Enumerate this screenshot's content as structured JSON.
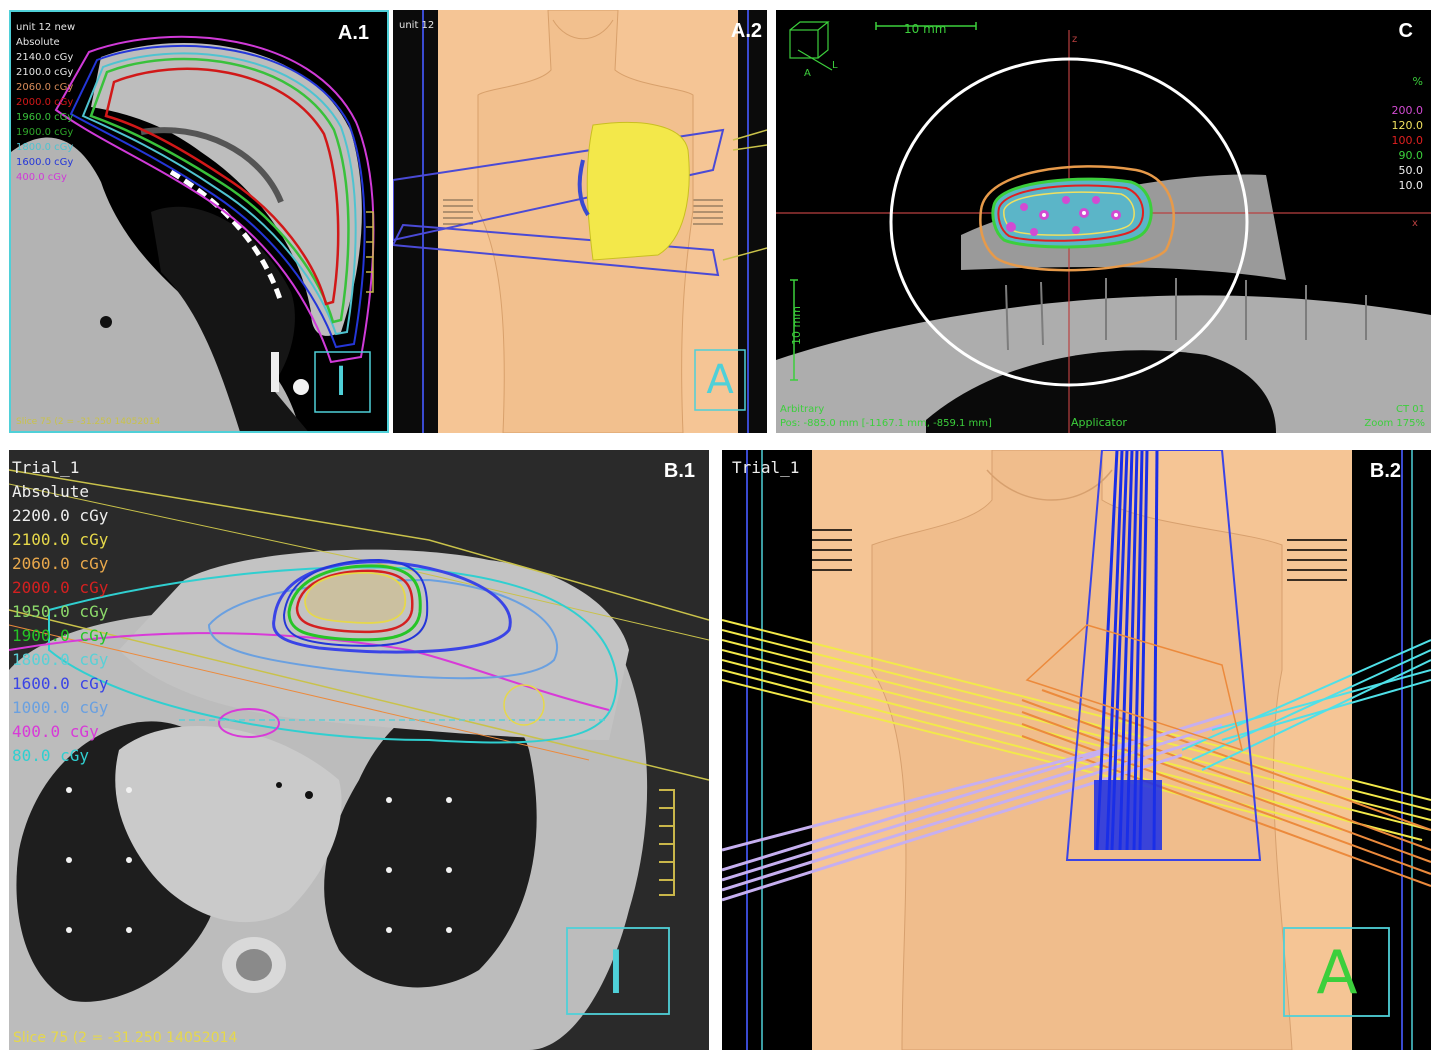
{
  "panels": {
    "a1": {
      "label": "A.1",
      "plan_name": "unit 12 new",
      "mode": "Absolute",
      "levels": [
        {
          "text": "2140.0 cGy",
          "color": "#e6e6e6"
        },
        {
          "text": "2100.0 cGy",
          "color": "#e6e6e6"
        },
        {
          "text": "2060.0 cGy",
          "color": "#d98c5a"
        },
        {
          "text": "2000.0 cGy",
          "color": "#d11818"
        },
        {
          "text": "1960.0 cGy",
          "color": "#39c13b"
        },
        {
          "text": "1900.0 cGy",
          "color": "#2fa52a"
        },
        {
          "text": "1800.0 cGy",
          "color": "#4fc3d0"
        },
        {
          "text": "1600.0 cGy",
          "color": "#2436d8"
        },
        {
          "text": "400.0 cGy",
          "color": "#d03ad8"
        }
      ],
      "slice_text": "Slice 75 (2 = -31.250 14052014"
    },
    "a2": {
      "label": "A.2",
      "plan_name": "unit 12"
    },
    "c": {
      "label": "C",
      "scale_label": "10 mm",
      "scale_vertical": "10 mm",
      "axis_z": "z",
      "axis_x": "x",
      "orient_a": "A",
      "orient_l": "L",
      "pct_header": "%",
      "percent_levels": [
        {
          "text": "200.0",
          "color": "#d24bd2"
        },
        {
          "text": "120.0",
          "color": "#f0e060"
        },
        {
          "text": "100.0",
          "color": "#e02020"
        },
        {
          "text": "90.0",
          "color": "#3ccf3c"
        },
        {
          "text": "50.0",
          "color": "#f0f0f0"
        },
        {
          "text": "10.0",
          "color": "#f0f0f0"
        }
      ],
      "bottom_left_1": "Arbitrary",
      "bottom_left_2": "Pos: -885.0 mm [-1167.1 mm, -859.1 mm]",
      "bottom_center": "Applicator",
      "bottom_right_1": "CT 01",
      "bottom_right_2": "Zoom 175%"
    },
    "b1": {
      "label": "B.1",
      "trial": "Trial_1",
      "mode": "Absolute",
      "levels": [
        {
          "text": "2200.0 cGy",
          "color": "#eeeeee"
        },
        {
          "text": "2100.0 cGy",
          "color": "#e6d84a"
        },
        {
          "text": "2060.0 cGy",
          "color": "#e9a84b"
        },
        {
          "text": "2000.0 cGy",
          "color": "#d42020"
        },
        {
          "text": "1950.0 cGy",
          "color": "#8cd96a"
        },
        {
          "text": "1900.0 cGy",
          "color": "#26c526"
        },
        {
          "text": "1800.0 cGy",
          "color": "#5ad0d6"
        },
        {
          "text": "1600.0 cGy",
          "color": "#3a44e6"
        },
        {
          "text": "1000.0 cGy",
          "color": "#6aa0e0"
        },
        {
          "text": "400.0 cGy",
          "color": "#d83ad8"
        },
        {
          "text": "80.0 cGy",
          "color": "#30cfd0"
        }
      ],
      "slice_text": "Slice 75 (2 = -31.250 14052014"
    },
    "b2": {
      "label": "B.2",
      "trial": "Trial_1"
    }
  },
  "colors": {
    "panel_border_a1": "#4fd0d8",
    "skin": "#f5c595",
    "ct_gray": "#b9b9b9",
    "frame_gray": "#222222"
  },
  "icons": [
    "orientation-I-icon",
    "orientation-A-icon",
    "orientation-cube-icon"
  ]
}
